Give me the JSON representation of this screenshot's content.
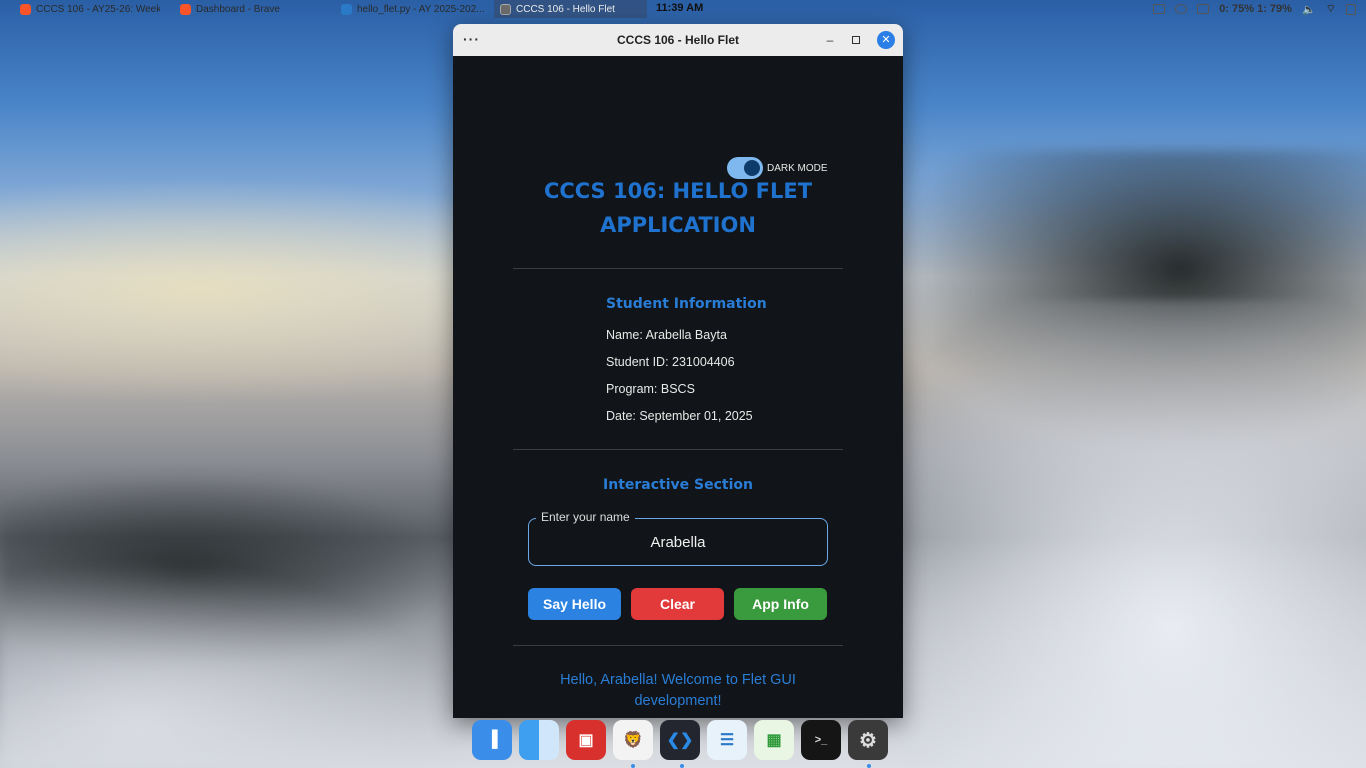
{
  "taskbar": {
    "tasks": [
      {
        "label": "CCCS 106 - AY25-26: Week...",
        "icon": "brave-icon"
      },
      {
        "label": "Dashboard - Brave",
        "icon": "brave-icon"
      },
      {
        "label": "hello_flet.py - AY 2025-202...",
        "icon": "vscode-icon"
      },
      {
        "label": "CCCS 106 - Hello Flet",
        "icon": "flet-icon",
        "active": true
      }
    ],
    "clock": "11:39 AM",
    "battery": "0: 75%  1: 79%"
  },
  "window": {
    "title": "CCCS 106 - Hello Flet",
    "menu_glyph": "···",
    "minimize_glyph": "–",
    "close_glyph": "✕"
  },
  "app": {
    "dark_mode_label": "DARK MODE",
    "dark_mode_on": true,
    "title_line1": "CCCS 106: HELLO FLET",
    "title_line2": "APPLICATION",
    "student_section_title": "Student Information",
    "student": {
      "name": "Name: Arabella Bayta",
      "id": "Student ID: 231004406",
      "program": "Program: BSCS",
      "date": "Date: September 01, 2025"
    },
    "interactive_section_title": "Interactive Section",
    "name_field_label": "Enter your name",
    "name_field_value": "Arabella",
    "buttons": {
      "say_hello": "Say Hello",
      "clear": "Clear",
      "app_info": "App Info"
    },
    "greeting": "Hello, Arabella! Welcome to Flet GUI development!"
  },
  "dock": {
    "items": [
      {
        "name": "plasma-icon",
        "glyph": "▐"
      },
      {
        "name": "finder-icon",
        "glyph": ""
      },
      {
        "name": "screenshot-icon",
        "glyph": "▣"
      },
      {
        "name": "brave-icon",
        "glyph": "🦁"
      },
      {
        "name": "vscode-icon",
        "glyph": "❮❯"
      },
      {
        "name": "document-viewer-icon",
        "glyph": "☰"
      },
      {
        "name": "spreadsheet-icon",
        "glyph": "▦"
      },
      {
        "name": "terminal-icon",
        "glyph": ">_"
      },
      {
        "name": "settings-icon",
        "glyph": "⚙"
      }
    ]
  },
  "colors": {
    "accent": "#1f73cf",
    "say_hello": "#2b82e0",
    "clear": "#e23a3a",
    "app_info": "#3a9a3e",
    "window_bg": "#111418"
  }
}
